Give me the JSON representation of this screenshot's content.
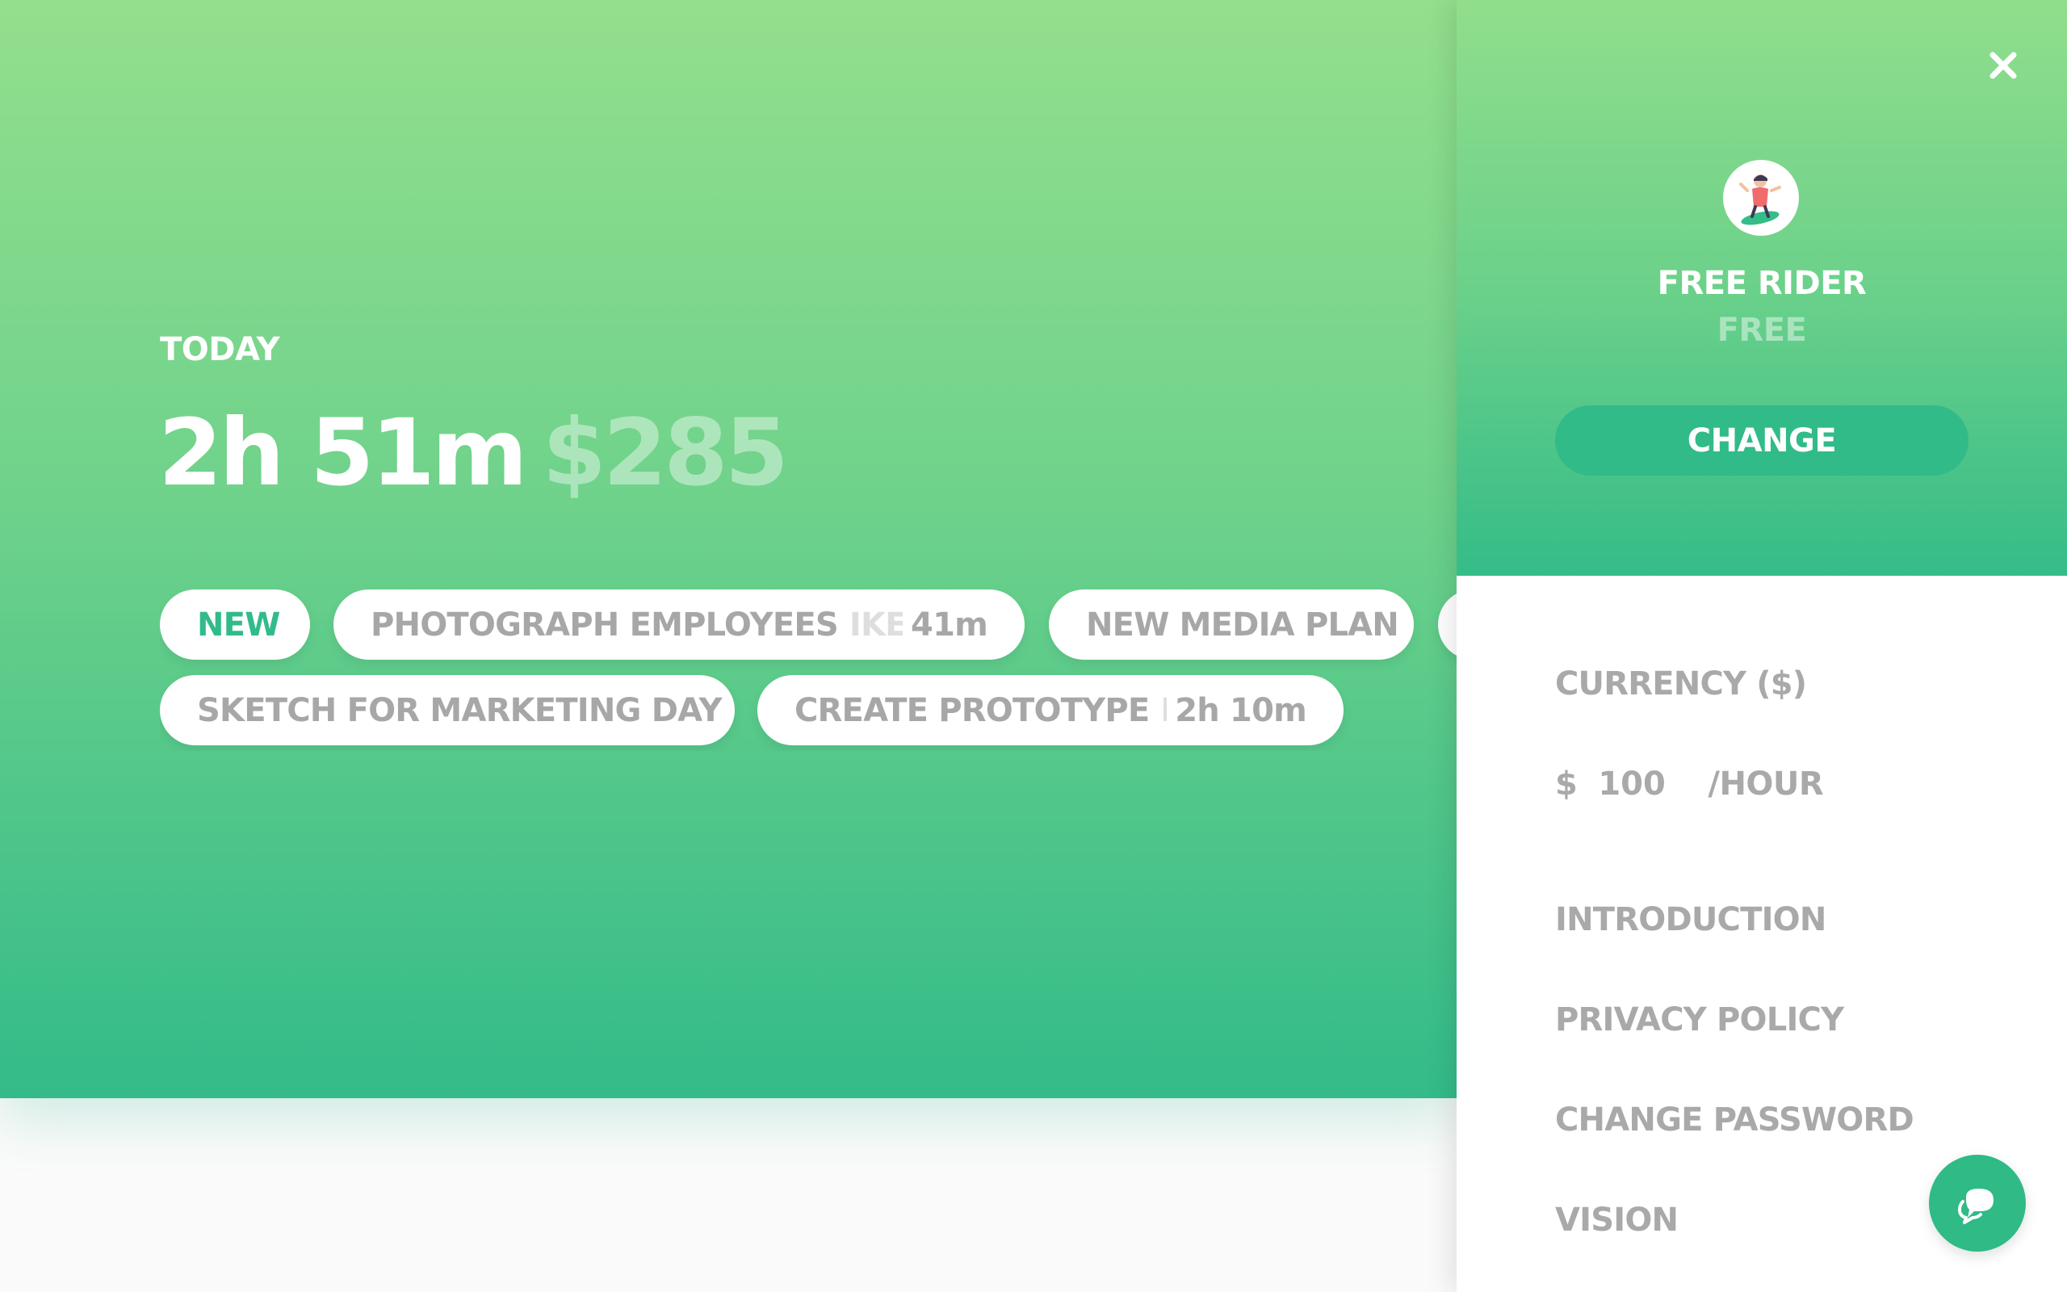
{
  "summary": {
    "heading": "TODAY",
    "time": "2h 51m",
    "earnings": "$285"
  },
  "tasks": [
    {
      "label": "NEW"
    },
    {
      "label": "PHOTOGRAPH EMPLOYEES",
      "client": "IKEA",
      "duration": "41m"
    },
    {
      "label": "NEW MEDIA PLAN"
    },
    {
      "label": "SKETCH FOR MARKETING DAY"
    },
    {
      "label": "CREATE PROTOTYPE",
      "client": "IKEA",
      "duration": "2h 10m"
    }
  ],
  "panel": {
    "plan_name": "FREE RIDER",
    "plan_tier": "FREE",
    "change_label": "CHANGE",
    "currency_label": "CURRENCY ($)",
    "rate": {
      "symbol": "$",
      "value": "100",
      "unit": "/HOUR"
    },
    "menu": [
      {
        "label": "INTRODUCTION"
      },
      {
        "label": "PRIVACY POLICY"
      },
      {
        "label": "CHANGE PASSWORD"
      },
      {
        "label": "VISION"
      }
    ]
  },
  "icons": {
    "close": "close-icon",
    "avatar": "surfer-avatar-icon",
    "chat": "chat-bubbles-icon"
  },
  "colors": {
    "accent": "#32bb8a",
    "gradient_top": "#93df8d",
    "gradient_bottom": "#33bb89",
    "muted_text": "#a9a9a9"
  }
}
